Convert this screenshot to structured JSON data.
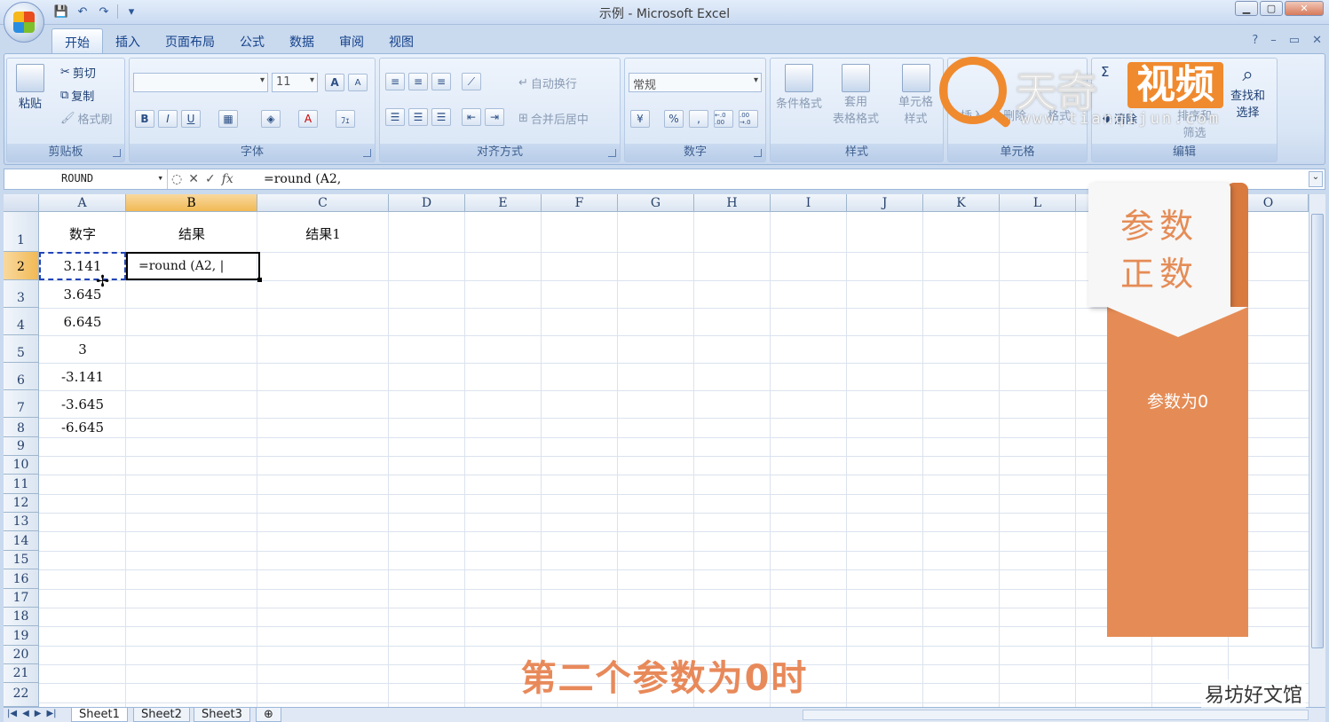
{
  "window": {
    "title": "示例 - Microsoft Excel"
  },
  "ribbon": {
    "tabs": [
      "开始",
      "插入",
      "页面布局",
      "公式",
      "数据",
      "审阅",
      "视图"
    ],
    "clipboard": {
      "paste": "粘贴",
      "cut": "剪切",
      "copy": "复制",
      "format_painter": "格式刷",
      "label": "剪贴板"
    },
    "font": {
      "size": "11",
      "bold": "B",
      "italic": "I",
      "underline": "U",
      "grow": "A",
      "shrink": "A",
      "color_a": "A",
      "phonetic": "ﾌｪ",
      "label": "字体"
    },
    "alignment": {
      "wrap": "自动换行",
      "merge": "合并后居中",
      "label": "对齐方式"
    },
    "number": {
      "format": "常规",
      "percent": "%",
      "comma": ",",
      "inc": "←.0 .00",
      "dec": ".00 →.0",
      "label": "数字"
    },
    "styles": {
      "conditional": "条件格式",
      "table_1": "套用",
      "table_2": "表格格式",
      "cell_1": "单元格",
      "cell_2": "样式",
      "label": "样式"
    },
    "cells": {
      "insert": "插入",
      "delete": "删除",
      "format": "格式",
      "label": "单元格"
    },
    "editing": {
      "sigma": "Σ",
      "clear": "清除",
      "sort_1": "排序和",
      "sort_2": "筛选",
      "find_1": "查找和",
      "find_2": "选择",
      "label": "编辑"
    }
  },
  "formula_bar": {
    "name_box": "ROUND",
    "cancel": "✕",
    "enter": "✓",
    "fx": "fx",
    "formula": "=round (A2,"
  },
  "columns": [
    "A",
    "B",
    "C",
    "D",
    "E",
    "F",
    "G",
    "H",
    "I",
    "J",
    "K",
    "L",
    "O"
  ],
  "rows": [
    "1",
    "2",
    "3",
    "4",
    "5",
    "6",
    "7",
    "8",
    "9",
    "10",
    "11",
    "12",
    "13",
    "14",
    "15",
    "16",
    "17",
    "18",
    "19",
    "20",
    "21",
    "22"
  ],
  "cells": {
    "A1": "数字",
    "B1": "结果",
    "C1": "结果1",
    "A2": "3.141",
    "A3": "3.645",
    "A4": "6.645",
    "A5": "3",
    "A6": "-3.141",
    "A7": "-3.645",
    "A8": "-6.645",
    "B2": "=round (A2, |"
  },
  "sheets": [
    "Sheet1",
    "Sheet2",
    "Sheet3"
  ],
  "overlay": {
    "banner_title": "参数正数",
    "banner_note": "参数为0",
    "caption": "第二个参数为0时",
    "watermark_brand": "天奇",
    "watermark_tag": "视频",
    "watermark_url": "www.tianqijun.com",
    "corner_watermark": "易坊好文馆"
  },
  "colors": {
    "accent_orange": "#e58c56",
    "ribbon_blue": "#15428b"
  }
}
